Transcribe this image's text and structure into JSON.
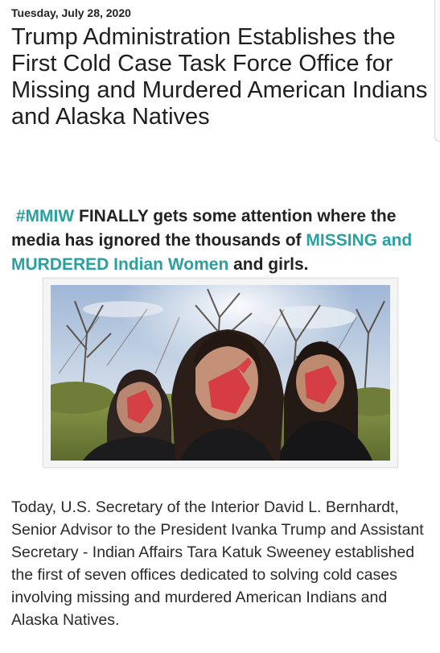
{
  "post": {
    "date": "Tuesday, July 28, 2020",
    "title": "Trump Administration Establishes the First Cold Case Task Force Office for Missing and Murdered American Indians and Alaska Natives",
    "hashtag": "#MMIW",
    "lead_part1": " FINALLY gets some attention where the media has ignored the thousands of ",
    "lead_highlight": "MISSING and MURDERED Indian Women",
    "lead_part2": " and girls.",
    "body": "Today, U.S. Secretary of the Interior David L. Bernhardt, Senior Advisor to the President Ivanka Trump and Assistant Secretary - Indian Affairs Tara Katuk Sweeney established the first of seven offices dedicated to solving cold cases involving missing and murdered American Indians and Alaska Natives."
  },
  "photo": {
    "icon": "photo-three-women-red-handprints"
  },
  "colors": {
    "accent": "#2aa0a0",
    "text": "#1e1e1e",
    "handprint": "#d8343c"
  }
}
